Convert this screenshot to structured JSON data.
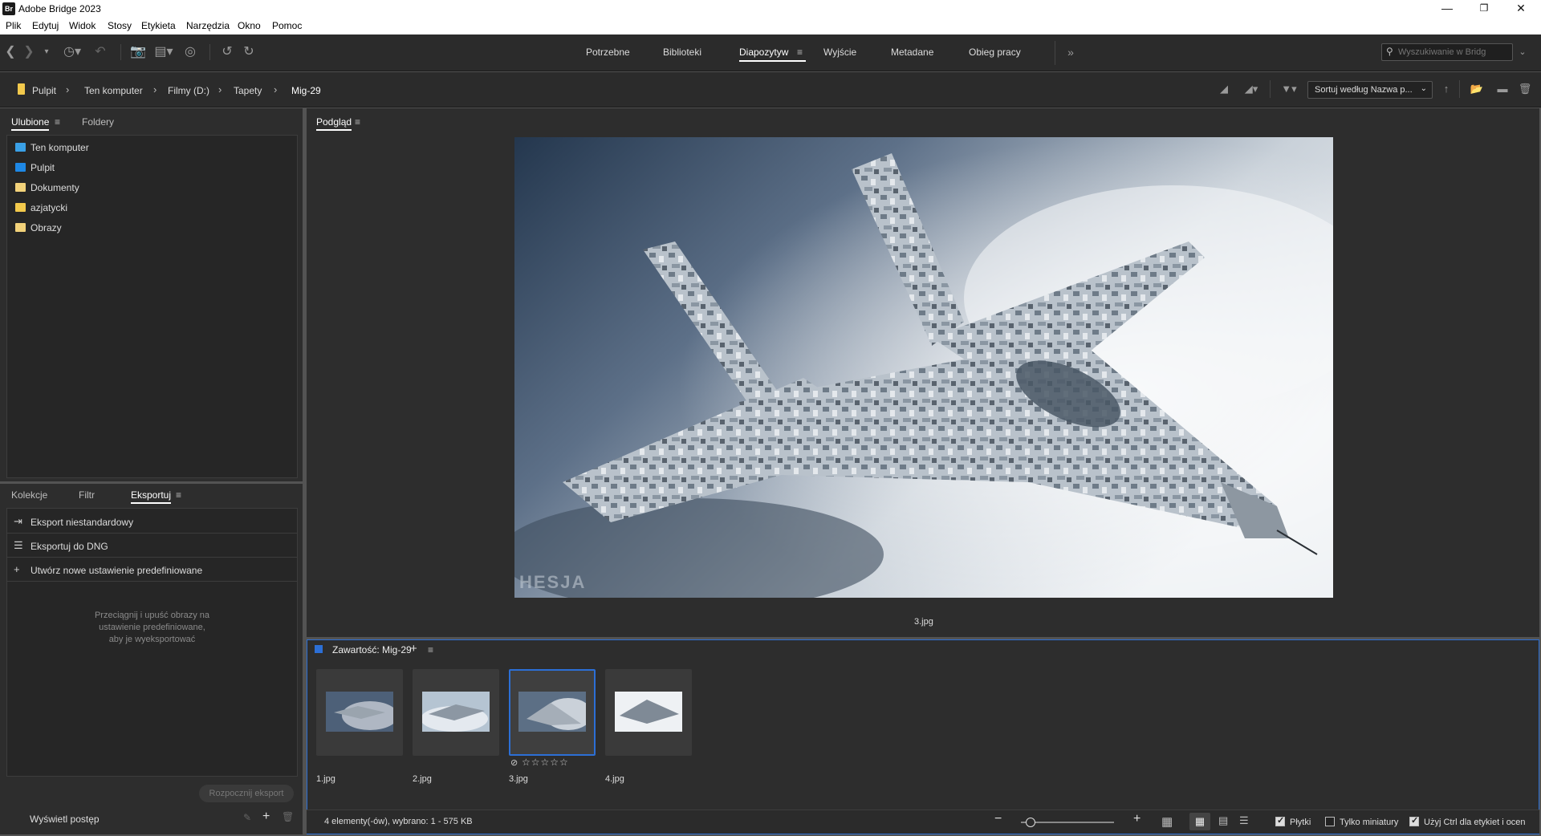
{
  "window": {
    "app_title": "Adobe Bridge 2023",
    "logo_text": "Br",
    "minimize": "—",
    "restore": "❐",
    "close": "✕"
  },
  "menu": [
    "Plik",
    "Edytuj",
    "Widok",
    "Stosy",
    "Etykieta",
    "Narzędzia",
    "Okno",
    "Pomoc"
  ],
  "workspaces": [
    "Potrzebne",
    "Biblioteki",
    "Diapozytyw",
    "Wyjście",
    "Metadane",
    "Obieg pracy"
  ],
  "active_workspace": "Diapozytyw",
  "search": {
    "placeholder": "Wyszukiwanie w Bridg"
  },
  "breadcrumb": [
    "Pulpit",
    "Ten komputer",
    "Filmy (D:)",
    "Tapety",
    "Mig-29"
  ],
  "sort": {
    "label": "Sortuj według Nazwa p..."
  },
  "left_top": {
    "tabs": [
      "Ulubione",
      "Foldery"
    ],
    "favorites": [
      {
        "label": "Ten komputer",
        "icon": "computer-icon",
        "color": "#3aa0e6"
      },
      {
        "label": "Pulpit",
        "icon": "desktop-folder-icon",
        "color": "#1e88e5"
      },
      {
        "label": "Dokumenty",
        "icon": "documents-folder-icon",
        "color": "#f2d27a"
      },
      {
        "label": "azjatycki",
        "icon": "folder-icon",
        "color": "#f2c94c"
      },
      {
        "label": "Obrazy",
        "icon": "pictures-folder-icon",
        "color": "#f2d27a"
      }
    ]
  },
  "left_bottom": {
    "tabs": [
      "Kolekcje",
      "Filtr",
      "Eksportuj"
    ],
    "export_items": [
      "Eksport niestandardowy",
      "Eksportuj do DNG",
      "Utwórz nowe ustawienie predefiniowane"
    ],
    "drop_hint": [
      "Przeciągnij i upuść obrazy na",
      "ustawienie predefiniowane,",
      "aby je wyeksportować"
    ],
    "start_export": "Rozpocznij eksport",
    "progress": "Wyświetl postęp"
  },
  "preview": {
    "title": "Podgląd",
    "filename": "3.jpg",
    "watermark": "HESJA"
  },
  "content": {
    "title": "Zawartość: Mig-29",
    "items": [
      {
        "label": "1.jpg",
        "selected": false
      },
      {
        "label": "2.jpg",
        "selected": false
      },
      {
        "label": "3.jpg",
        "selected": true,
        "rating": "☆☆☆☆☆"
      },
      {
        "label": "4.jpg",
        "selected": false
      }
    ]
  },
  "status": {
    "summary": "4 elementy(-ów), wybrano: 1 - 575 KB",
    "tiles_label": "Płytki",
    "thumbs_only_label": "Tylko miniatury",
    "ctrl_label": "Użyj Ctrl dla etykiet i ocen",
    "tiles_checked": true,
    "thumbs_only_checked": false,
    "ctrl_checked": true
  },
  "colors": {
    "accent": "#2c6fd6",
    "panel": "#2d2d2d",
    "toolbar": "#2b2b2b"
  }
}
